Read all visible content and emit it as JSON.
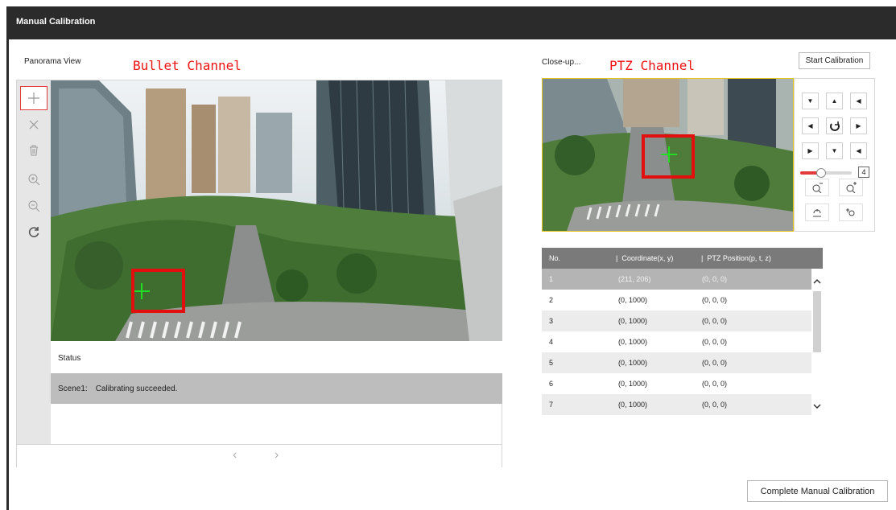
{
  "window": {
    "title": "Manual Calibration"
  },
  "panorama": {
    "label": "Panorama View",
    "overlay_label": "Bullet Channel",
    "tools": [
      "plus-icon",
      "close-icon",
      "trash-icon",
      "zoom-in-icon",
      "zoom-out-icon",
      "refresh-icon"
    ],
    "status": {
      "header": "Status",
      "scene": "Scene1:",
      "message": "Calibrating succeeded."
    },
    "pager": {
      "prev": "‹",
      "next": "›"
    }
  },
  "closeup": {
    "label": "Close-up...",
    "overlay_label": "PTZ Channel",
    "start_button": "Start Calibration",
    "ptz": {
      "speed_value": "4",
      "speed_fraction": 0.4,
      "icons": [
        "pan-left-up-icon",
        "tilt-up-icon",
        "pan-right-up-icon",
        "pan-left-icon",
        "auto-rotate-icon",
        "pan-right-icon",
        "pan-left-down-icon",
        "tilt-down-icon",
        "pan-right-down-icon",
        "zoom-out-lens-icon",
        "zoom-in-lens-icon",
        "focus-near-icon",
        "focus-far-icon"
      ]
    }
  },
  "table": {
    "headers": [
      "No.",
      "Coordinate(x, y)",
      "PTZ Position(p, t, z)"
    ],
    "rows": [
      {
        "no": "1",
        "coord": "(211, 206)",
        "ptz": "(0, 0, 0)"
      },
      {
        "no": "2",
        "coord": "(0, 1000)",
        "ptz": "(0, 0, 0)"
      },
      {
        "no": "3",
        "coord": "(0, 1000)",
        "ptz": "(0, 0, 0)"
      },
      {
        "no": "4",
        "coord": "(0, 1000)",
        "ptz": "(0, 0, 0)"
      },
      {
        "no": "5",
        "coord": "(0, 1000)",
        "ptz": "(0, 0, 0)"
      },
      {
        "no": "6",
        "coord": "(0, 1000)",
        "ptz": "(0, 0, 0)"
      },
      {
        "no": "7",
        "coord": "(0, 1000)",
        "ptz": "(0, 0, 0)"
      }
    ]
  },
  "footer": {
    "complete_button": "Complete Manual Calibration"
  },
  "colors": {
    "titlebar": "#2b2b2b",
    "accent_red": "#e30e0e",
    "table_header": "#7a7a7a",
    "selected_row": "#b4b4b4",
    "marker_green": "#22dd22"
  }
}
